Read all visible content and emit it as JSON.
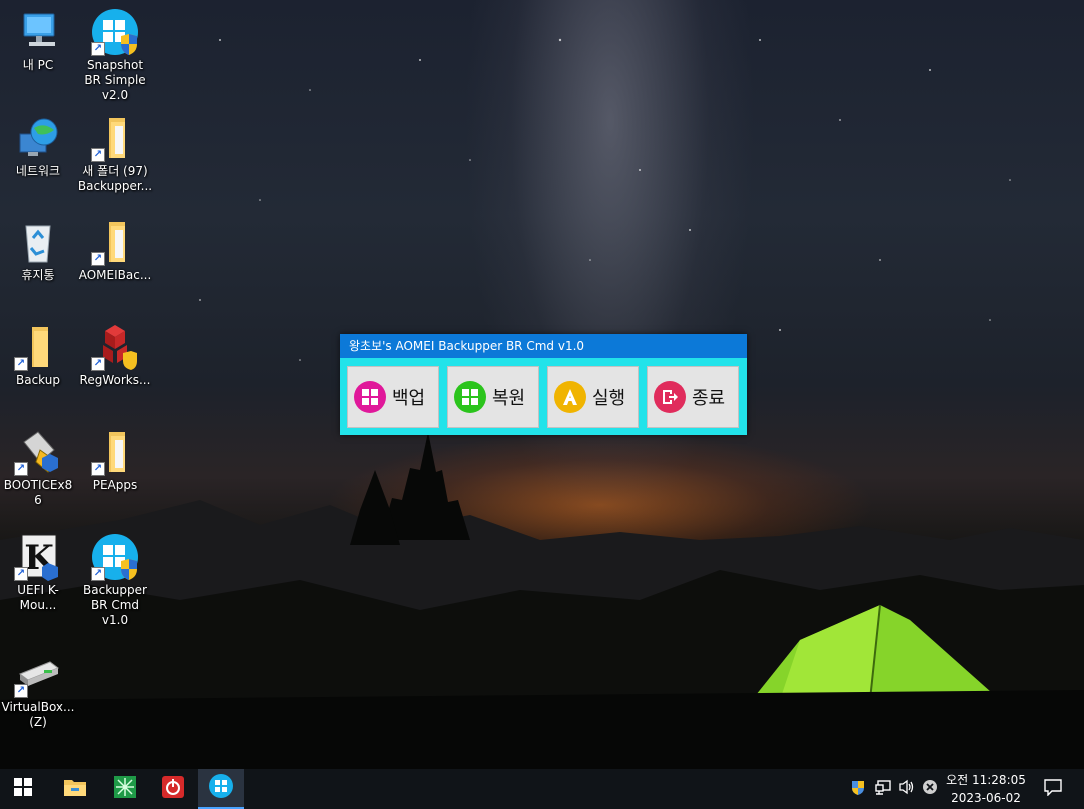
{
  "desktop": {
    "icons": [
      {
        "label": "내 PC",
        "icon": "this-pc-icon"
      },
      {
        "label": "Snapshot BR Simple v2.0",
        "icon": "windows-logo-shield-icon"
      },
      {
        "label": "네트워크",
        "icon": "network-globe-icon"
      },
      {
        "label": "새 폴더 (97) Backupper...",
        "icon": "folder-icon"
      },
      {
        "label": "휴지통",
        "icon": "recycle-bin-icon"
      },
      {
        "label": "AOMEIBac...",
        "icon": "folder-icon"
      },
      {
        "label": "Backup",
        "icon": "folder-icon"
      },
      {
        "label": "RegWorks...",
        "icon": "regworks-cubes-icon"
      },
      {
        "label": "BOOTICEx86",
        "icon": "bootice-tool-icon"
      },
      {
        "label": "PEApps",
        "icon": "folder-icon"
      },
      {
        "label": "UEFI K-Mou...",
        "icon": "k-mount-icon"
      },
      {
        "label": "Backupper BR Cmd v1.0",
        "icon": "windows-logo-shield-icon"
      },
      {
        "label": "VirtualBox... (Z)",
        "icon": "network-drive-icon"
      }
    ]
  },
  "app": {
    "title": "왕초보's AOMEI Backupper BR Cmd v1.0",
    "buttons": [
      {
        "label": "백업",
        "icon": "windows-logo-icon",
        "color": "#e0189a"
      },
      {
        "label": "복원",
        "icon": "windows-logo-icon",
        "color": "#2bc41c"
      },
      {
        "label": "실행",
        "icon": "letter-a-icon",
        "color": "#f0b400"
      },
      {
        "label": "종료",
        "icon": "exit-door-icon",
        "color": "#e02c5c"
      }
    ],
    "colors": {
      "titlebar": "#0c79d8",
      "frame": "#22e3ea",
      "button_bg": "#e4e4e4"
    }
  },
  "taskbar": {
    "pinned": [
      {
        "name": "start",
        "icon": "windows-start-icon"
      },
      {
        "name": "file-explorer",
        "icon": "file-explorer-icon"
      },
      {
        "name": "spreadsheet-app",
        "icon": "green-grid-icon"
      },
      {
        "name": "power-app",
        "icon": "red-power-icon"
      },
      {
        "name": "backupper-app",
        "icon": "windows-logo-icon",
        "active": true
      }
    ],
    "tray": [
      "shield-tray-icon",
      "network-tray-icon",
      "volume-icon",
      "close-circle-icon"
    ],
    "clock": {
      "time": "오전 11:28:05",
      "date": "2023-06-02"
    },
    "notification_icon": "notification-icon"
  }
}
